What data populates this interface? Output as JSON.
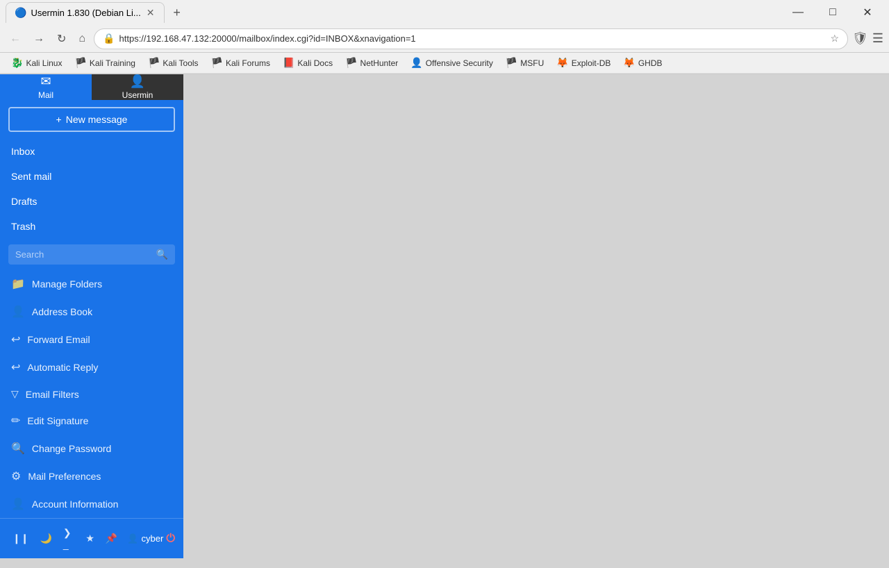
{
  "browser": {
    "tab_title": "Usermin 1.830 (Debian Li...",
    "tab_favicon": "🔵",
    "new_tab_label": "+",
    "url": "https://192.168.47.132:20000/mailbox/index.cgi?id=INBOX&xnavigation=1",
    "nav_back": "←",
    "nav_forward": "→",
    "nav_refresh": "↻",
    "nav_home": "⌂",
    "titlebar_minimize": "—",
    "titlebar_maximize": "□",
    "titlebar_close": "✕",
    "bookmarks": [
      {
        "id": "kali-linux",
        "icon": "🐉",
        "label": "Kali Linux"
      },
      {
        "id": "kali-training",
        "icon": "🏴",
        "label": "Kali Training"
      },
      {
        "id": "kali-tools",
        "icon": "🏴",
        "label": "Kali Tools"
      },
      {
        "id": "kali-forums",
        "icon": "🏴",
        "label": "Kali Forums"
      },
      {
        "id": "kali-docs",
        "icon": "📕",
        "label": "Kali Docs"
      },
      {
        "id": "nethunter",
        "icon": "🏴",
        "label": "NetHunter"
      },
      {
        "id": "offensive-security",
        "icon": "👤",
        "label": "Offensive Security"
      },
      {
        "id": "msfu",
        "icon": "🏴",
        "label": "MSFU"
      },
      {
        "id": "exploit-db",
        "icon": "🦊",
        "label": "Exploit-DB"
      },
      {
        "id": "ghdb",
        "icon": "🦊",
        "label": "GHDB"
      }
    ]
  },
  "sidebar": {
    "tabs": [
      {
        "id": "mail",
        "label": "Mail",
        "icon": "✉",
        "active": true
      },
      {
        "id": "usermin",
        "label": "Usermin",
        "icon": "👤",
        "active": false
      }
    ],
    "new_message_label": "+ New message",
    "nav_items": [
      {
        "id": "inbox",
        "label": "Inbox"
      },
      {
        "id": "sent-mail",
        "label": "Sent mail"
      },
      {
        "id": "drafts",
        "label": "Drafts"
      },
      {
        "id": "trash",
        "label": "Trash"
      }
    ],
    "search_placeholder": "Search",
    "menu_items": [
      {
        "id": "manage-folders",
        "icon": "📁",
        "label": "Manage Folders"
      },
      {
        "id": "address-book",
        "icon": "👤",
        "label": "Address Book"
      },
      {
        "id": "forward-email",
        "icon": "↩",
        "label": "Forward Email"
      },
      {
        "id": "automatic-reply",
        "icon": "↩",
        "label": "Automatic Reply"
      },
      {
        "id": "email-filters",
        "icon": "▽",
        "label": "Email Filters"
      },
      {
        "id": "edit-signature",
        "icon": "✏",
        "label": "Edit Signature"
      },
      {
        "id": "change-password",
        "icon": "🔍",
        "label": "Change Password"
      },
      {
        "id": "mail-preferences",
        "icon": "⚙",
        "label": "Mail Preferences"
      },
      {
        "id": "account-information",
        "icon": "👤",
        "label": "Account Information"
      }
    ],
    "bottom_toolbar": [
      {
        "id": "btn1",
        "icon": "❙❙"
      },
      {
        "id": "btn2",
        "icon": "🌙"
      },
      {
        "id": "btn3",
        "icon": "❯_"
      },
      {
        "id": "btn4",
        "icon": "★"
      },
      {
        "id": "btn5",
        "icon": "📌"
      }
    ],
    "username": "cyber",
    "logout_icon": "⏻"
  }
}
